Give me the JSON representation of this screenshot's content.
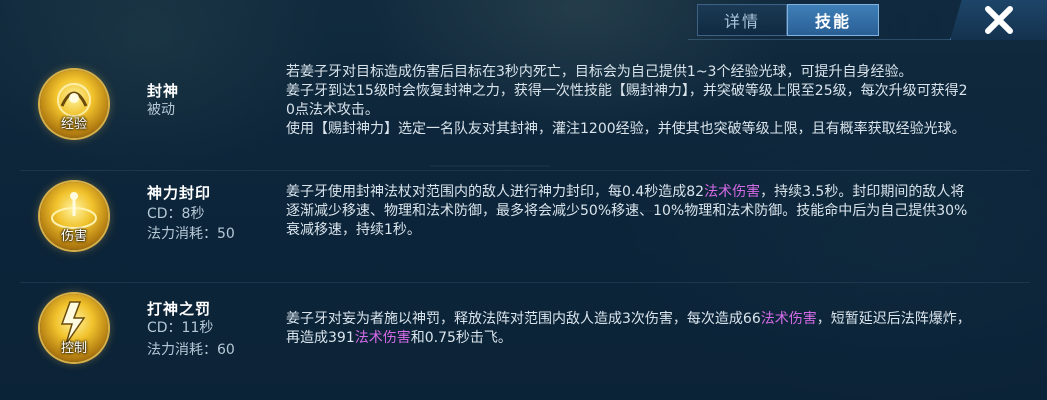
{
  "tabs": [
    {
      "label": "详情",
      "active": false
    },
    {
      "label": "技能",
      "active": true
    }
  ],
  "close_icon": "close-x-icon",
  "skills": [
    {
      "name": "封神",
      "type": "被动",
      "icon_tag": "经验",
      "icon": "exp-orb-icon",
      "desc_lines": [
        "若姜子牙对目标造成伤害后目标在3秒内死亡，目标会为自己提供1~3个经验光球，可提升自身经验。",
        "姜子牙到达15级时会恢复封神之力，获得一次性技能【赐封神力】，并突破等级上限至25级，每次升级可获得2",
        "0点法术攻击。",
        "使用【赐封神力】选定一名队友对其封神，灌注1200经验，并使其也突破等级上限，且有概率获取经验光球。"
      ]
    },
    {
      "name": "神力封印",
      "cd": "CD：8秒",
      "cost": "法力消耗：50",
      "icon_tag": "伤害",
      "icon": "seal-icon",
      "desc": {
        "l1_a": "姜子牙使用封神法杖对范围内的敌人进行神力封印，每0.4秒造成82",
        "l1_hl": "法术伤害",
        "l1_b": "，持续3.5秒。封印期间的敌人将",
        "l2": "逐渐减少移速、物理和法术防御，最多将会减少50%移速、10%物理和法术防御。技能命中后为自己提供30%",
        "l3": "衰减移速，持续1秒。"
      }
    },
    {
      "name": "打神之罚",
      "cd": "CD：11秒",
      "cost": "法力消耗：60",
      "icon_tag": "控制",
      "icon": "lightning-punish-icon",
      "desc": {
        "l1_a": "姜子牙对妄为者施以神罚，释放法阵对范围内敌人造成3次伤害，每次造成66",
        "l1_hl": "法术伤害",
        "l1_b": "，短暂延迟后法阵爆炸，",
        "l2_a": "再造成391",
        "l2_hl": "法术伤害",
        "l2_b": "和0.75秒击飞。"
      }
    }
  ],
  "colors": {
    "highlight": "#d36ae6",
    "tab_active": "#3f7fb8",
    "icon_gold": "#f1c22c"
  }
}
